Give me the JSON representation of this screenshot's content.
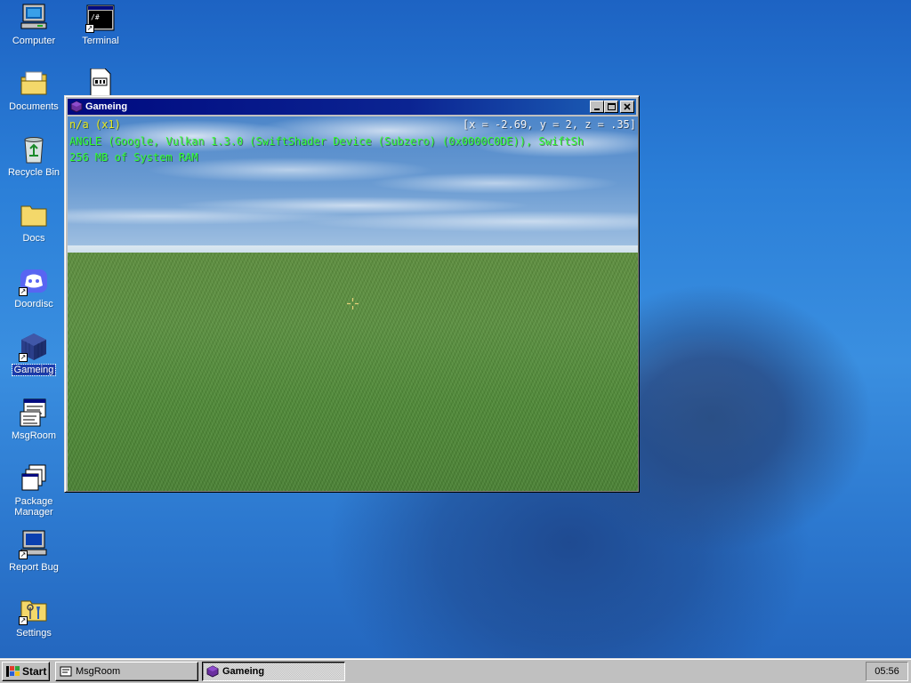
{
  "desktop": {
    "icons": [
      {
        "label": "Computer"
      },
      {
        "label": "Terminal"
      },
      {
        "label": "Documents"
      },
      {
        "label": "Recycle Bin"
      },
      {
        "label": "Docs"
      },
      {
        "label": "Doordisc"
      },
      {
        "label": "Gameing"
      },
      {
        "label": "MsgRoom"
      },
      {
        "label": "Package Manager"
      },
      {
        "label": "Report Bug"
      },
      {
        "label": "Settings"
      }
    ]
  },
  "window": {
    "title": "Gameing",
    "hud": {
      "mode": "n/a (x1)",
      "coords": "[x = -2.69, y = 2, z = .35]",
      "renderer": "ANGLE (Google, Vulkan 1.3.0 (SwiftShader Device (Subzero) (0x0000C0DE)), SwiftSh",
      "memory": "256 MB of System RAM"
    }
  },
  "taskbar": {
    "start_label": "Start",
    "tasks": [
      {
        "label": "MsgRoom",
        "active": false
      },
      {
        "label": "Gameing",
        "active": true
      }
    ],
    "clock": "05:56"
  },
  "colors": {
    "hud_green": "#33ff33",
    "hud_yellow": "#e8e820",
    "titlebar": "#000a80",
    "selection": "#1c3cad"
  }
}
